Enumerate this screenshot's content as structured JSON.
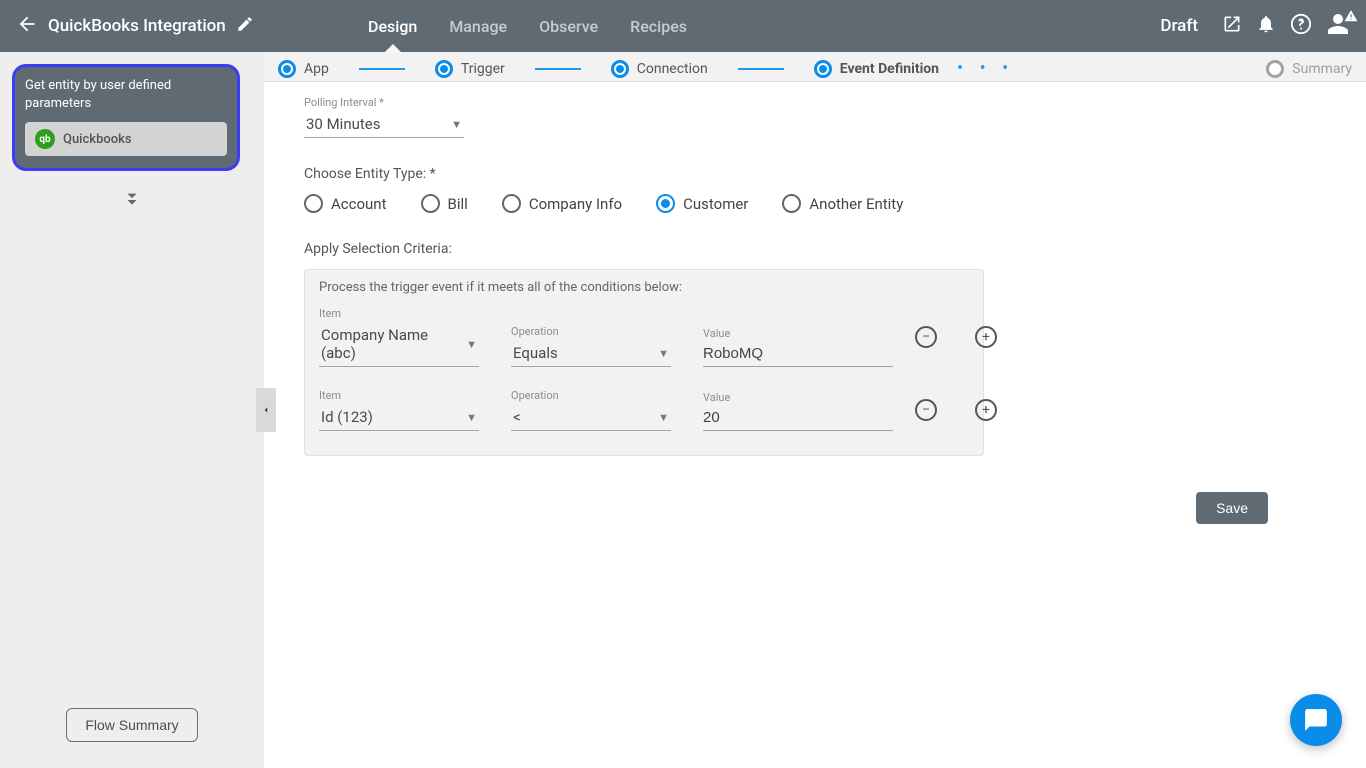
{
  "header": {
    "title": "QuickBooks Integration",
    "status": "Draft",
    "nav": [
      "Design",
      "Manage",
      "Observe",
      "Recipes"
    ],
    "active_nav_index": 0
  },
  "sidebar": {
    "node_title": "Get entity by user defined parameters",
    "node_app": "Quickbooks",
    "flow_summary_btn": "Flow Summary"
  },
  "stepper": {
    "steps": [
      "App",
      "Trigger",
      "Connection",
      "Event Definition",
      "Summary"
    ],
    "active_index": 3,
    "disabled_index": 4
  },
  "form": {
    "polling_label": "Polling Interval *",
    "polling_value": "30 Minutes",
    "entity_label": "Choose Entity Type: *",
    "entity_options": [
      "Account",
      "Bill",
      "Company Info",
      "Customer",
      "Another Entity"
    ],
    "entity_selected_index": 3,
    "criteria_heading": "Apply Selection Criteria:",
    "criteria_caption": "Process the trigger event if it meets all of the conditions below:",
    "col_item": "Item",
    "col_operation": "Operation",
    "col_value": "Value",
    "rows": [
      {
        "item": "Company Name  (abc)",
        "operation": "Equals",
        "value": "RoboMQ"
      },
      {
        "item": "Id (123)",
        "operation": "<",
        "value": "20"
      }
    ],
    "save_label": "Save"
  },
  "icons": {
    "back": "back-arrow-icon",
    "edit": "pencil-icon",
    "external": "open-external-icon",
    "bell": "bell-icon",
    "help": "help-icon",
    "user": "user-icon",
    "warn": "warning-icon",
    "chat": "chat-icon",
    "collapse": "chevron-left-icon",
    "addnode": "double-chevron-down-icon",
    "caret": "caret-down-icon",
    "remove": "minus-icon",
    "add": "plus-icon"
  }
}
